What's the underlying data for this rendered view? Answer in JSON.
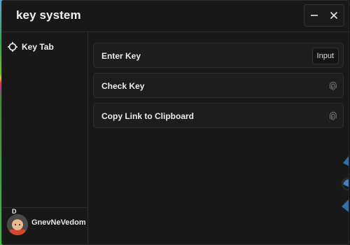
{
  "window": {
    "title": "key system"
  },
  "window_controls": {
    "minimize_icon": "minus-icon",
    "close_icon": "close-icon"
  },
  "sidebar": {
    "tabs": [
      {
        "label": "Key Tab",
        "icon": "crosshair-icon"
      }
    ],
    "profile": {
      "initial": "D",
      "username": "GnevNeVedom"
    }
  },
  "main": {
    "rows": [
      {
        "label": "Enter Key",
        "control": "input",
        "input_text": "Input"
      },
      {
        "label": "Check Key",
        "control": "button",
        "icon": "fingerprint-icon"
      },
      {
        "label": "Copy Link to Clipboard",
        "control": "button",
        "icon": "fingerprint-icon"
      }
    ]
  },
  "colors": {
    "background": "#181818",
    "border": "#2c2c2c",
    "text": "#ececec"
  }
}
